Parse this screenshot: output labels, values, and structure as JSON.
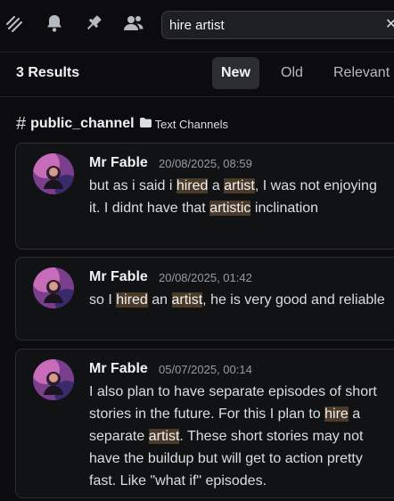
{
  "search": {
    "value": "hire artist",
    "clear_glyph": "✕"
  },
  "toolbar": {
    "icons": [
      "threads-icon",
      "bell-icon",
      "pin-icon",
      "members-icon"
    ]
  },
  "results": {
    "count_label": "3 Results",
    "sort_tabs": [
      {
        "label": "New",
        "active": true
      },
      {
        "label": "Old",
        "active": false
      },
      {
        "label": "Relevant",
        "active": false
      }
    ]
  },
  "channel": {
    "name": "public_channel",
    "category": "Text Channels"
  },
  "messages": [
    {
      "author": "Mr Fable",
      "timestamp": "20/08/2025, 08:59",
      "segments": [
        {
          "text": "but as i said i "
        },
        {
          "text": "hired",
          "hl": true
        },
        {
          "text": " a "
        },
        {
          "text": "artist",
          "hl": true
        },
        {
          "text": ", I was not enjoying it. I didnt have that "
        },
        {
          "text": "artistic",
          "hl": true
        },
        {
          "text": " inclination"
        }
      ]
    },
    {
      "author": "Mr Fable",
      "timestamp": "20/08/2025, 01:42",
      "segments": [
        {
          "text": "so I "
        },
        {
          "text": "hired",
          "hl": true
        },
        {
          "text": " an "
        },
        {
          "text": "artist",
          "hl": true
        },
        {
          "text": ", he is very good and reliable"
        }
      ]
    },
    {
      "author": "Mr Fable",
      "timestamp": "05/07/2025, 00:14",
      "segments": [
        {
          "text": "I also plan to have separate episodes of short stories in the future. For this I plan to "
        },
        {
          "text": "hire",
          "hl": true
        },
        {
          "text": " a separate "
        },
        {
          "text": "artist",
          "hl": true
        },
        {
          "text": ". These short stories may not have the buildup but will get to action pretty fast.  Like \"what if\" episodes."
        }
      ]
    }
  ],
  "colors": {
    "highlight": "#4a3a27",
    "background": "#0c0c0e",
    "card": "#111214"
  }
}
